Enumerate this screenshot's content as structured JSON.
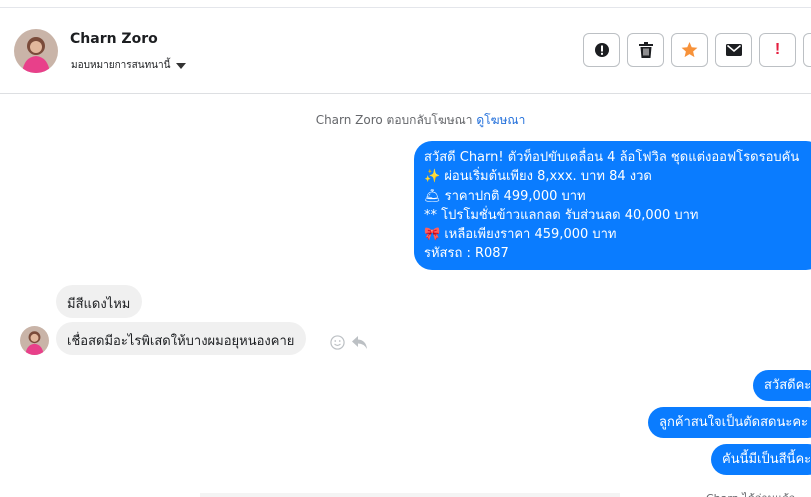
{
  "header": {
    "contact_name": "Charn Zoro",
    "assign_label": "มอบหมายการสนทนานี้",
    "actions": [
      {
        "name": "report-icon",
        "label": "!"
      },
      {
        "name": "trash-icon"
      },
      {
        "name": "star-icon"
      },
      {
        "name": "envelope-icon"
      },
      {
        "name": "exclamation-icon",
        "label": "!"
      },
      {
        "name": "more-icon"
      }
    ]
  },
  "conversation": {
    "ad_notice": {
      "prefix": "Charn Zoro ตอบกลับโฆษณา",
      "link": "ดูโฆษณา"
    },
    "ad_message": {
      "lines": [
        "สวัสดี Charn! ตัวท็อปขับเคลื่อน 4 ล้อโฟวิล ชุดแต่งออฟโรดรอบคัน",
        "✨  ผ่อนเริ่มต้นเพียง 8,xxx. บาท 84 งวด",
        "🛎 ราคาปกติ 499,000 บาท",
        "** โปรโมชั่นข้าวแลกลด รับส่วนลด 40,000 บาท",
        "🎀  เหลือเพียงราคา 459,000 บาท",
        " รหัสรถ : R087"
      ]
    },
    "incoming": [
      "มีสีแดงไหม",
      "เชื่อสดมีอะไรพิเสดให้บางผมอยุหนองคาย"
    ],
    "outgoing": [
      "สวัสดีคะ",
      "ลูกค้าสนใจเป็นตัดสดนะคะ",
      "คันนี้มีเป็นสีนี้คะ"
    ],
    "seen_text": "Charn ได้อ่านแล้ว"
  },
  "colors": {
    "accent": "#0a7cff",
    "star": "#f7923a",
    "alert": "#e41e3f",
    "link": "#216fdb"
  }
}
